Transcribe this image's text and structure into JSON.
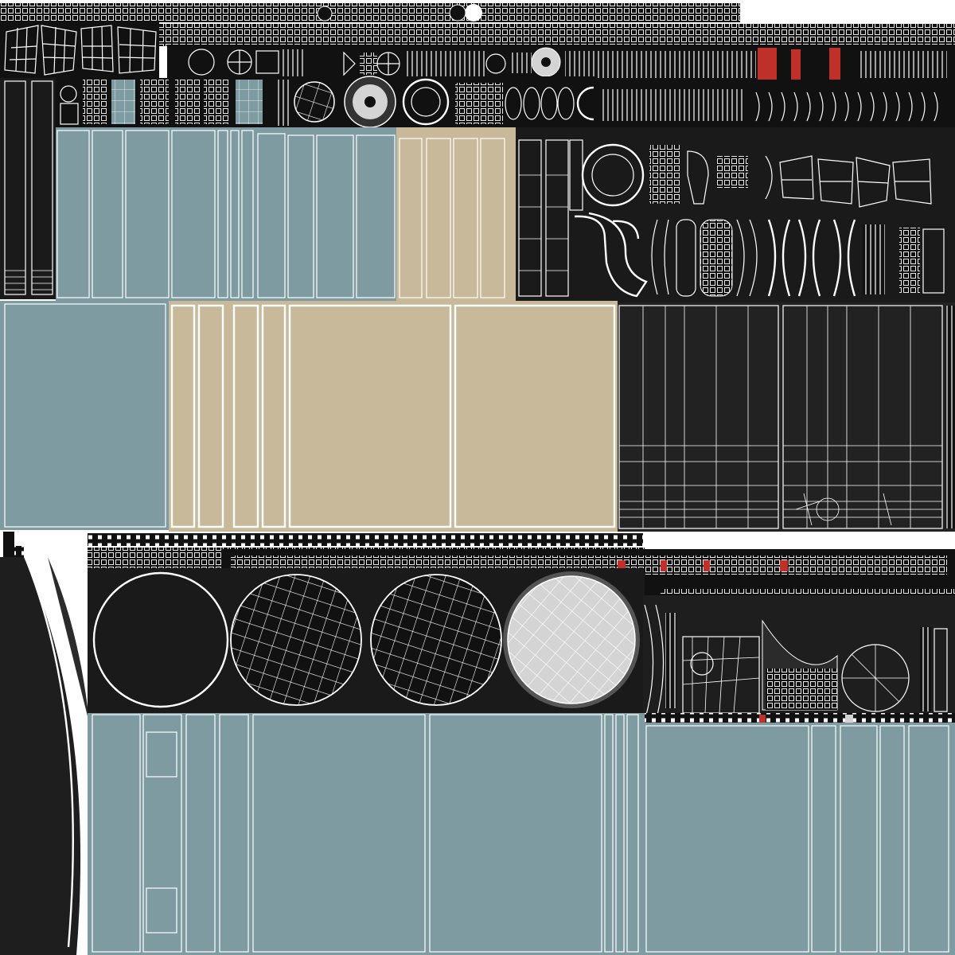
{
  "texture": {
    "colors": {
      "background": "#ffffff",
      "island_dark": "#2b2b2b",
      "island_black": "#111111",
      "blue_grey": "#7d9ba1",
      "tan": "#c8b99a",
      "wire": "#ffffff",
      "red_accent": "#c0302a",
      "light_grey": "#d4d4d4"
    }
  }
}
